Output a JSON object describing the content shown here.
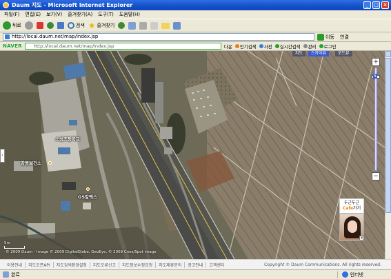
{
  "window": {
    "title": "Daum 지도 - Microsoft Internet Explorer"
  },
  "menu": [
    "파일(F)",
    "편집(E)",
    "보기(V)",
    "즐겨찾기(A)",
    "도구(T)",
    "도움말(H)"
  ],
  "toolbar": {
    "back_label": "뒤로",
    "search_label": "검색",
    "favorites_label": "즐겨찾기"
  },
  "address": {
    "url": "http://local.daum.net/map/index.jsp",
    "go_label": "이동",
    "links_label": "연결"
  },
  "naver": {
    "logo": "NAVER",
    "search_value": "http://local.daum.net/map/index.jsp",
    "items": [
      "다운",
      "인기검색",
      "사전",
      "실시간검색",
      "관리",
      "로그인"
    ]
  },
  "map": {
    "chips": [
      "지도",
      "스카이뷰",
      "로드뷰"
    ],
    "labels": {
      "school": "소성초등학교",
      "facility": "강동보건소",
      "gas_station": "GS칼텍스"
    },
    "zoom_level": "5",
    "scale_text": "5m",
    "copyright_overlay": "© 2009 Daum - Image © 2009 DigitalGlobe, GeoEye, © 2009 Cnes/Spot image"
  },
  "ad": {
    "line1": "두근두근",
    "cafe_word": "Cafe",
    "line2_suffix": "가기",
    "close": "×"
  },
  "footer": {
    "links": [
      "이용안내",
      "지도오픈API",
      "지도검색환경설정",
      "지도오류신고",
      "지도정보수정요청",
      "지도제휴문의",
      "광고안내",
      "고객센터"
    ],
    "copyright": "Copyright © Daum Communications. All rights reserved."
  },
  "status": {
    "left": "완료",
    "zone": "인터넷"
  }
}
